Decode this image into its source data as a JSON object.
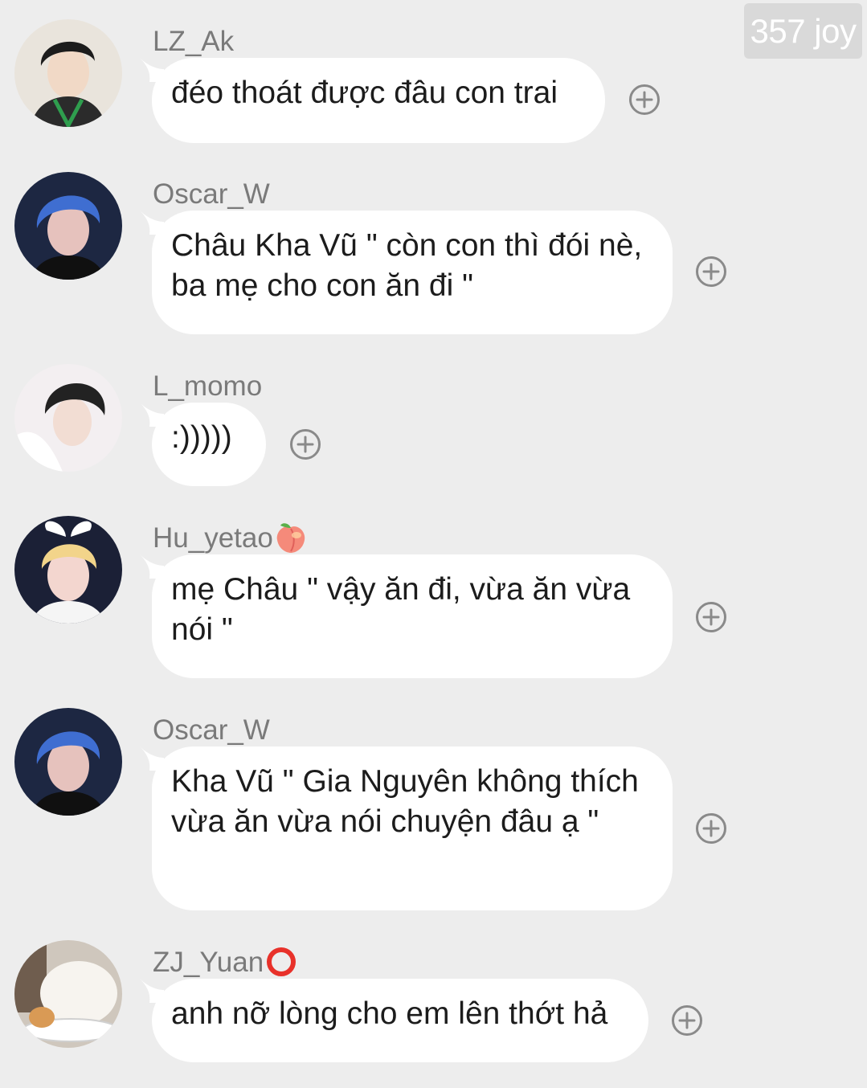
{
  "watermark": "357 joy",
  "colors": {
    "background": "#ededed",
    "bubble": "#ffffff",
    "username": "#7a7a7a",
    "text": "#1c1c1c",
    "plus_icon": "#8a8a8a"
  },
  "messages": [
    {
      "username": "LZ_Ak",
      "username_emoji": "",
      "text": "đéo thoát được đâu con trai",
      "avatar_icon": "avatar-person-icon",
      "action_icon": "add-reaction-icon"
    },
    {
      "username": "Oscar_W",
      "username_emoji": "",
      "text": "Châu Kha Vũ \" còn con thì đói nè, ba mẹ cho con ăn đi \"",
      "avatar_icon": "avatar-person-icon",
      "action_icon": "add-reaction-icon"
    },
    {
      "username": "L_momo",
      "username_emoji": "",
      "text": ":)))))",
      "avatar_icon": "avatar-person-icon",
      "action_icon": "add-reaction-icon"
    },
    {
      "username": "Hu_yetao",
      "username_emoji": "peach-emoji",
      "text": "mẹ Châu \" vậy ăn đi, vừa ăn vừa nói \"",
      "avatar_icon": "avatar-person-icon",
      "action_icon": "add-reaction-icon"
    },
    {
      "username": "Oscar_W",
      "username_emoji": "",
      "text": "Kha Vũ \" Gia Nguyên không thích vừa ăn vừa nói chuyện đâu ạ \"",
      "avatar_icon": "avatar-person-icon",
      "action_icon": "add-reaction-icon"
    },
    {
      "username": "ZJ_Yuan",
      "username_emoji": "red-circle-emoji",
      "text": "anh nỡ lòng cho em lên thớt hả",
      "avatar_icon": "avatar-cat-icon",
      "action_icon": "add-reaction-icon"
    }
  ]
}
